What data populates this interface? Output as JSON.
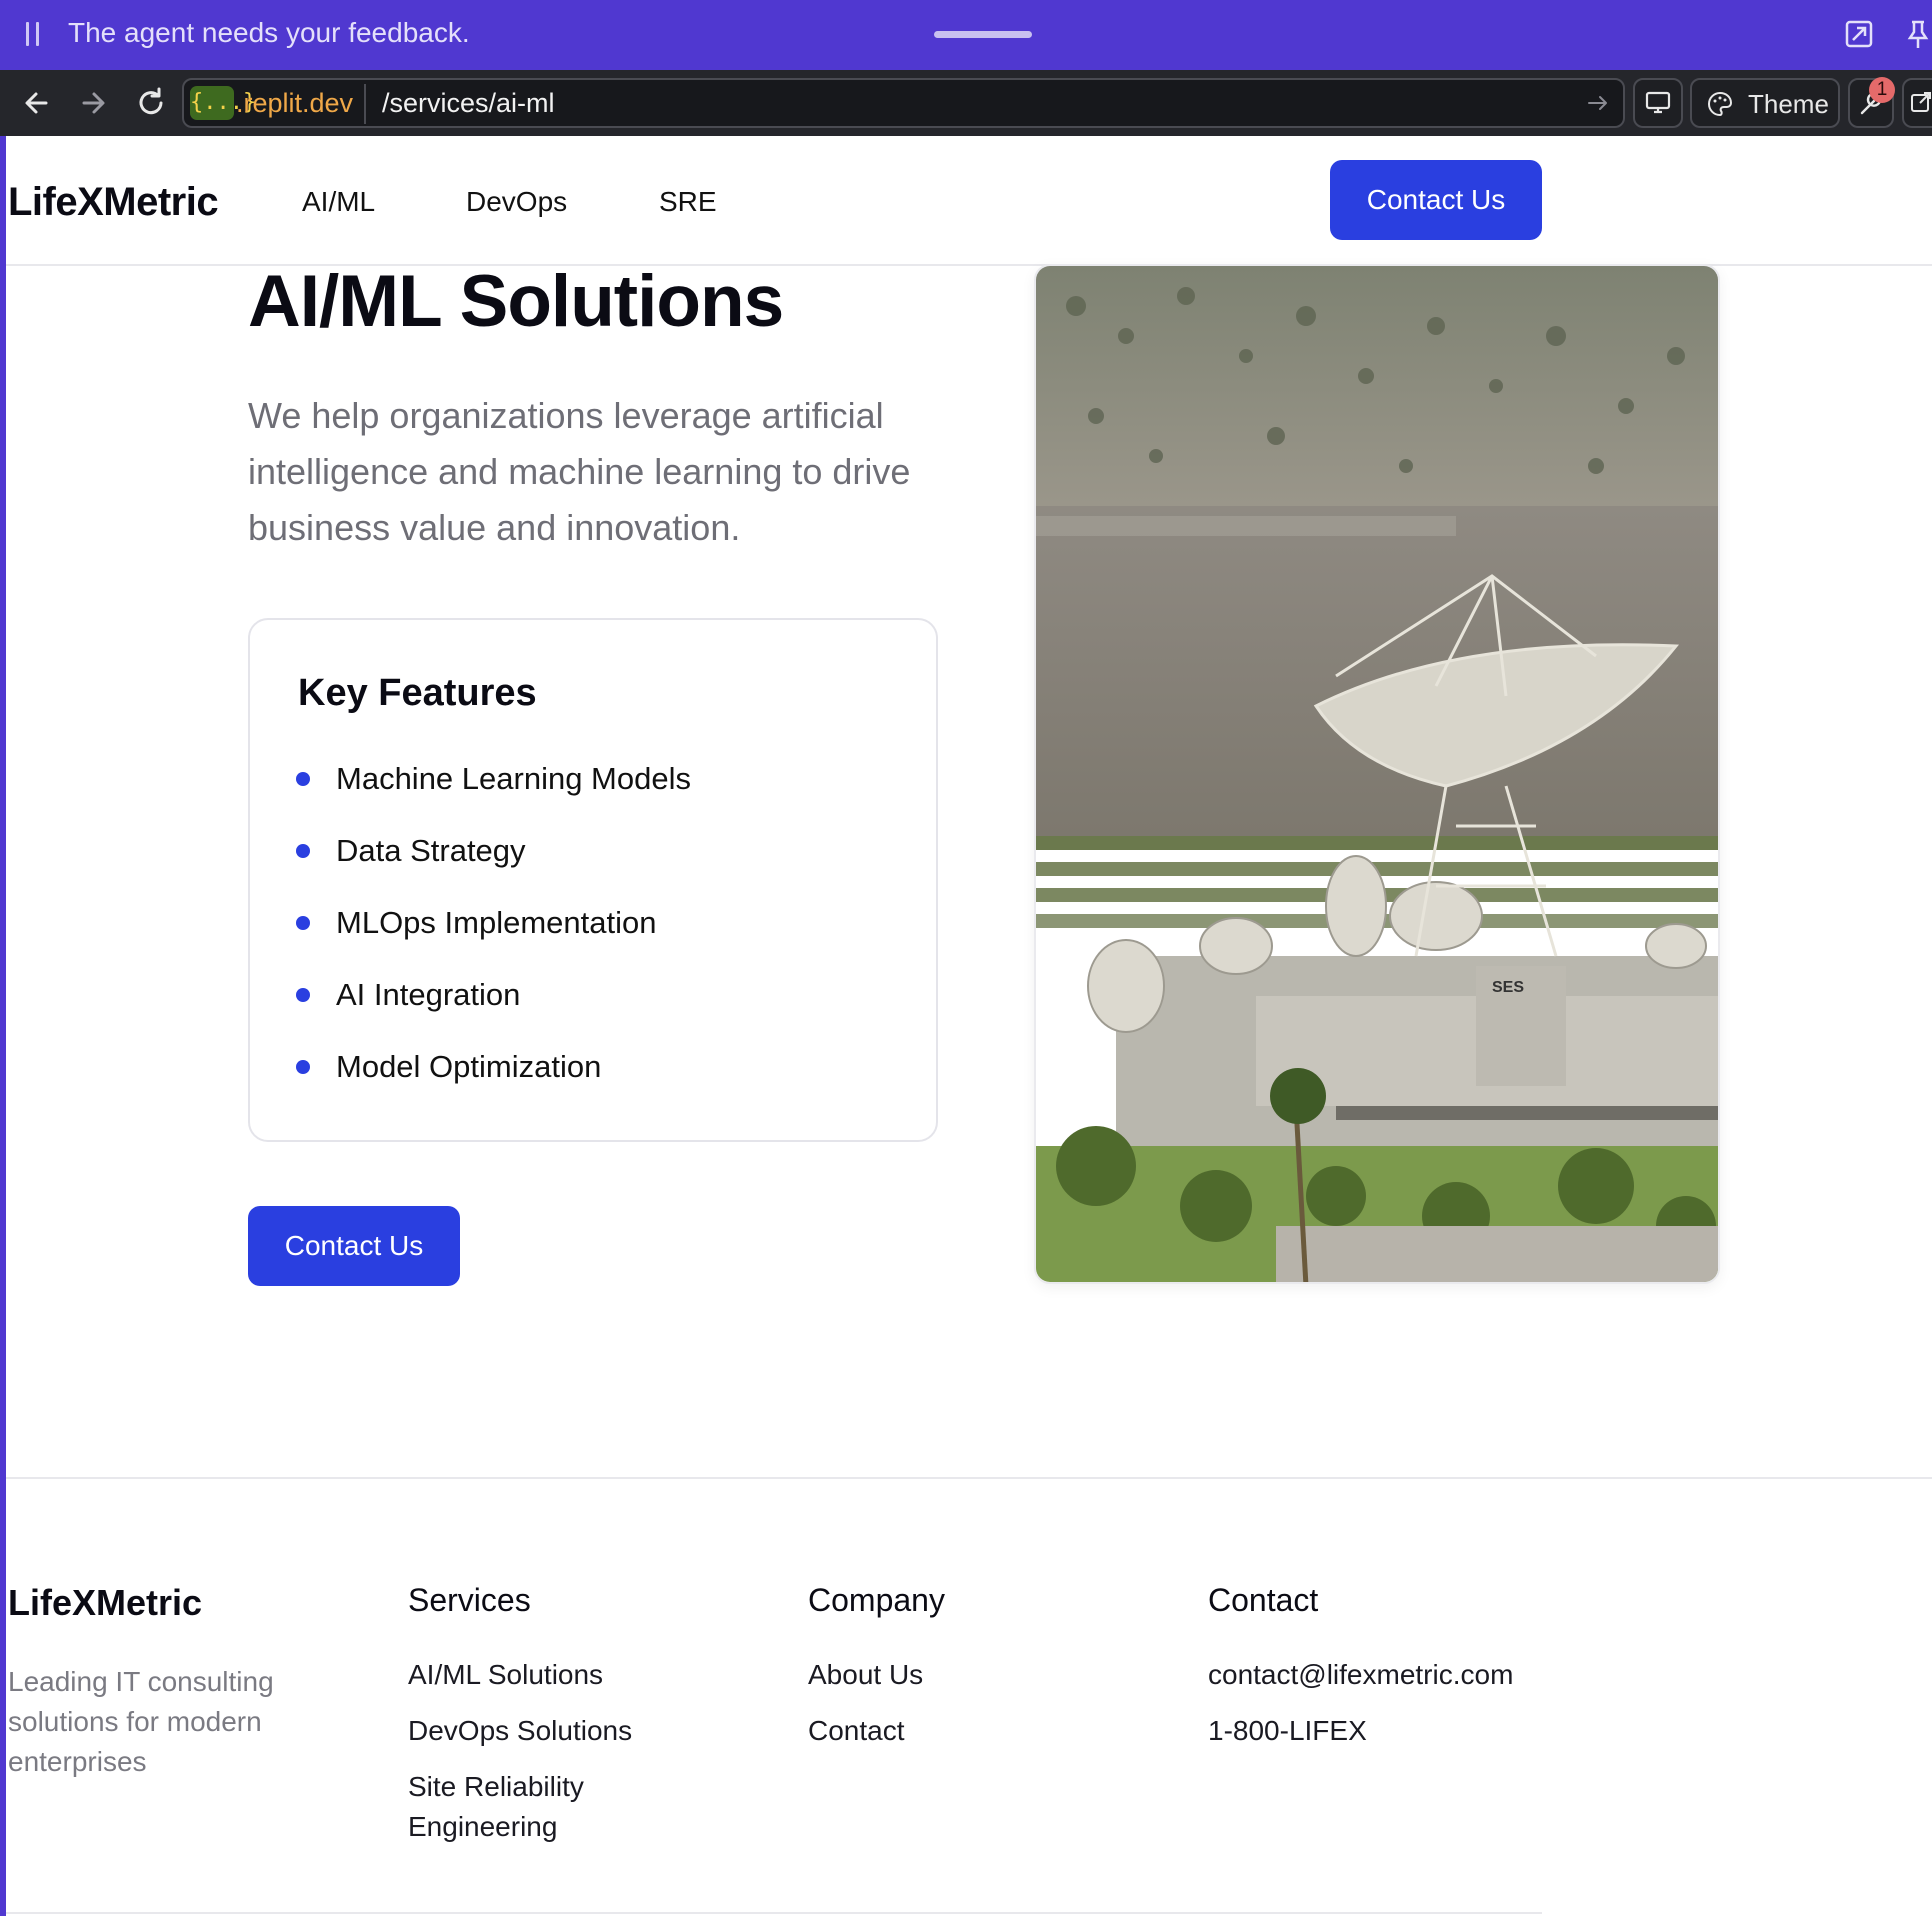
{
  "agent_banner": {
    "message": "The agent needs your feedback."
  },
  "browser": {
    "url_host_chip": "{...}",
    "url_host": ".replit.dev",
    "url_path": "/services/ai-ml",
    "theme_label": "Theme",
    "notification_count": "1"
  },
  "header": {
    "logo": "LifeXMetric",
    "nav": [
      "AI/ML",
      "DevOps",
      "SRE"
    ],
    "cta": "Contact Us"
  },
  "hero": {
    "title": "AI/ML Solutions",
    "description": "We help organizations leverage artificial intelligence and machine learning to drive business value and innovation.",
    "features_title": "Key Features",
    "features": [
      "Machine Learning Models",
      "Data Strategy",
      "MLOps Implementation",
      "AI Integration",
      "Model Optimization"
    ],
    "cta": "Contact Us",
    "image_sign_text": "SES"
  },
  "footer": {
    "logo": "LifeXMetric",
    "tagline": "Leading IT consulting solutions for modern enterprises",
    "services": {
      "title": "Services",
      "links": [
        "AI/ML Solutions",
        "DevOps Solutions",
        "Site Reliability Engineering"
      ]
    },
    "company": {
      "title": "Company",
      "links": [
        "About Us",
        "Contact"
      ]
    },
    "contact": {
      "title": "Contact",
      "email": "contact@lifexmetric.com",
      "phone": "1-800-LIFEX"
    }
  },
  "colors": {
    "agent_bar": "#5038d0",
    "primary": "#2a3fe0",
    "toolbar": "#25262b"
  },
  "icons": [
    "pause-icon",
    "open-external-icon",
    "pin-icon",
    "back-arrow-icon",
    "forward-arrow-icon",
    "reload-icon",
    "go-arrow-icon",
    "device-icon",
    "palette-icon",
    "tools-icon"
  ]
}
